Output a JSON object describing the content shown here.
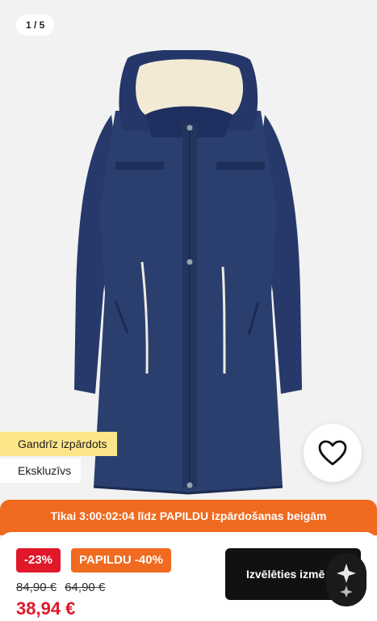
{
  "gallery": {
    "counter": "1 / 5",
    "image_alt": "navy-hooded-parka-coat"
  },
  "badges": {
    "almost_sold_out": "Gandrīz izpārdots",
    "exclusive": "Ekskluzīvs"
  },
  "favorite": {
    "icon": "heart-icon"
  },
  "banner": {
    "text": "Tikai 3:00:02:04 līdz PAPILDU izpārdošanas beigām"
  },
  "pricing": {
    "discount_tag": "-23%",
    "extra_tag": "PAPILDU -40%",
    "old_price_1": "84,90 €",
    "old_price_2": "64,90 €",
    "current_price": "38,94 €"
  },
  "cta": {
    "label": "Izvēlēties izmē"
  },
  "colors": {
    "accent_orange": "#f06a20",
    "sale_red": "#e0182a",
    "badge_yellow": "#fde68a",
    "coat_navy": "#2a3f6e"
  }
}
